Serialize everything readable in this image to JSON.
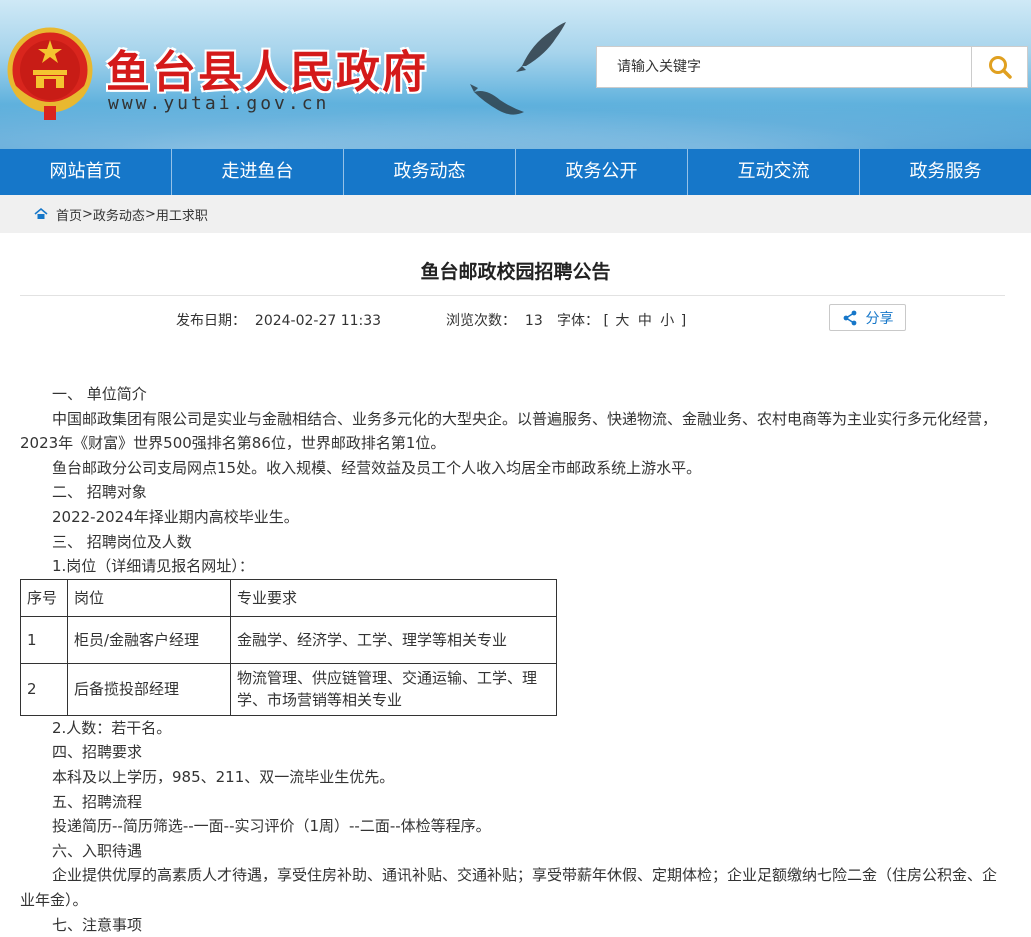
{
  "header": {
    "site_title": "鱼台县人民政府",
    "site_url": "www.yutai.gov.cn",
    "search_placeholder": "请输入关键字"
  },
  "nav": [
    "网站首页",
    "走进鱼台",
    "政务动态",
    "政务公开",
    "互动交流",
    "政务服务"
  ],
  "breadcrumb": {
    "items": [
      "首页",
      "政务动态",
      "用工求职"
    ],
    "sep": ">"
  },
  "article": {
    "title": "鱼台邮政校园招聘公告",
    "date_label": "发布日期：",
    "date": "2024-02-27 11:33",
    "views_label": "浏览次数：",
    "views": "13",
    "font_label": "字体：",
    "font_open": "[",
    "font_sizes": [
      "大",
      "中",
      "小"
    ],
    "font_close": "]",
    "share_label": "分享"
  },
  "content": {
    "s1_heading": "一、 单位简介",
    "s1_p1": "中国邮政集团有限公司是实业与金融相结合、业务多元化的大型央企。以普遍服务、快递物流、金融业务、农村电商等为主业实行多元化经营，2023年《财富》世界500强排名第86位，世界邮政排名第1位。",
    "s1_p2": "鱼台邮政分公司支局网点15处。收入规模、经营效益及员工个人收入均居全市邮政系统上游水平。",
    "s2_heading": "二、 招聘对象",
    "s2_p1": "2022-2024年择业期内高校毕业生。",
    "s3_heading": "三、 招聘岗位及人数",
    "s3_sub1": "1.岗位（详细请见报名网址）：",
    "table": {
      "headers": [
        "序号",
        "岗位",
        "专业要求"
      ],
      "rows": [
        [
          "1",
          "柜员/金融客户经理",
          "金融学、经济学、工学、理学等相关专业"
        ],
        [
          "2",
          "后备揽投部经理",
          "物流管理、供应链管理、交通运输、工学、理学、市场营销等相关专业"
        ]
      ]
    },
    "s3_sub2": "2.人数：若干名。",
    "s4_heading": "四、招聘要求",
    "s4_p1": "本科及以上学历，985、211、双一流毕业生优先。",
    "s5_heading": "五、招聘流程",
    "s5_p1": "投递简历--简历筛选--一面--实习评价（1周）--二面--体检等程序。",
    "s6_heading": "六、入职待遇",
    "s6_p1": "企业提供优厚的高素质人才待遇，享受住房补助、通讯补贴、交通补贴；享受带薪年休假、定期体检；企业足额缴纳七险二金（住房公积金、企业年金）。",
    "s7_heading": "七、注意事项"
  }
}
